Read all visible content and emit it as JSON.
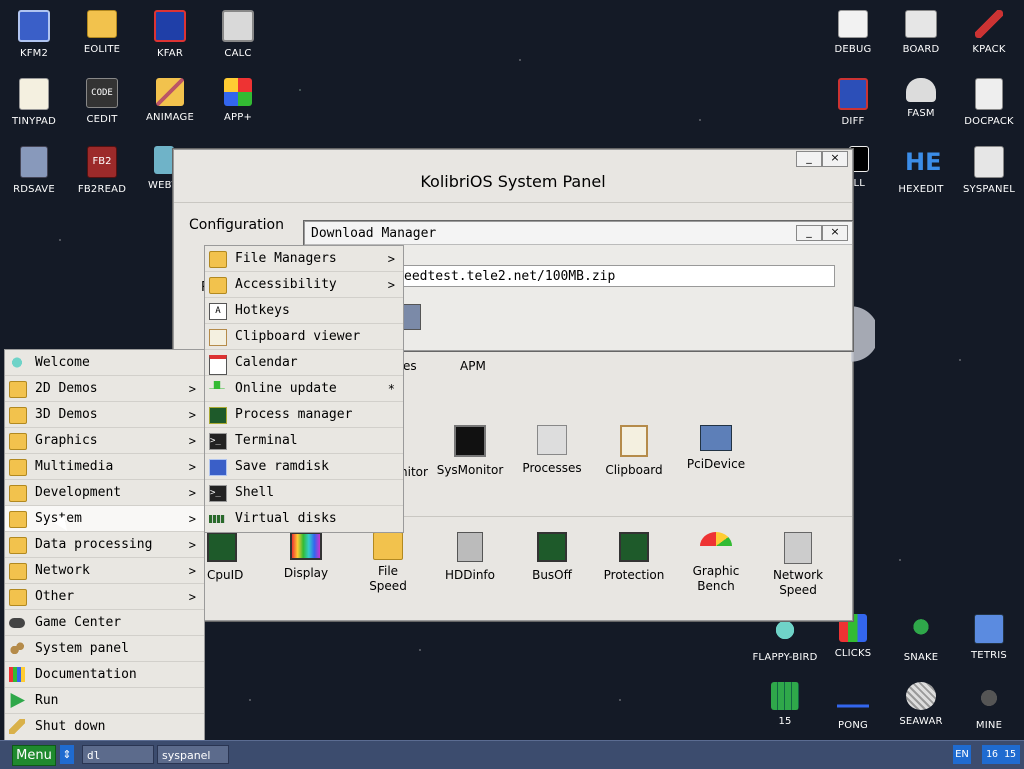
{
  "desktop_icons": [
    {
      "label": "KFM2",
      "icon": "floppy-icon"
    },
    {
      "label": "EOLITE",
      "icon": "folder-icon"
    },
    {
      "label": "KFAR",
      "icon": "kfar-icon"
    },
    {
      "label": "CALC",
      "icon": "calculator-icon"
    },
    {
      "label": "TINYPAD",
      "icon": "notepad-icon"
    },
    {
      "label": "CEDIT",
      "icon": "code-icon"
    },
    {
      "label": "ANIMAGE",
      "icon": "paint-icon"
    },
    {
      "label": "APP+",
      "icon": "cube-icon"
    },
    {
      "label": "RDSAVE",
      "icon": "ramdisk-icon"
    },
    {
      "label": "FB2READ",
      "icon": "book-icon"
    },
    {
      "label": "WEBV",
      "icon": "browser-icon"
    },
    {
      "label": "DEBUG",
      "icon": "bug-icon"
    },
    {
      "label": "BOARD",
      "icon": "board-icon"
    },
    {
      "label": "KPACK",
      "icon": "hammer-icon"
    },
    {
      "label": "DIFF",
      "icon": "diff-icon"
    },
    {
      "label": "FASM",
      "icon": "fasm-icon"
    },
    {
      "label": "DOCPACK",
      "icon": "docpack-icon"
    },
    {
      "label": "ELL",
      "icon": "shell-icon"
    },
    {
      "label": "HEXEDIT",
      "icon": "hex-icon"
    },
    {
      "label": "SYSPANEL",
      "icon": "sliders-icon"
    },
    {
      "label": "FLAPPY-BIRD",
      "icon": "bird-icon"
    },
    {
      "label": "CLICKS",
      "icon": "blocks-icon"
    },
    {
      "label": "SNAKE",
      "icon": "snake-icon"
    },
    {
      "label": "TETRIS",
      "icon": "tetris-icon"
    },
    {
      "label": "15",
      "icon": "grid15-icon"
    },
    {
      "label": "PONG",
      "icon": "pong-icon"
    },
    {
      "label": "SEAWAR",
      "icon": "ship-icon"
    },
    {
      "label": "MINE",
      "icon": "mine-icon"
    }
  ],
  "system_panel": {
    "title": "KolibriOS System Panel",
    "section_configuration": "Configuration",
    "partial_label_1": "R",
    "partial_label_2": "es",
    "tab_apm": "APM",
    "row1": [
      {
        "label": "nitor",
        "icon": "monitor-icon"
      },
      {
        "label": "SysMonitor",
        "icon": "sysmonitor-icon"
      },
      {
        "label": "Processes",
        "icon": "processes-icon"
      },
      {
        "label": "Clipboard",
        "icon": "clipboard-icon"
      },
      {
        "label": "PciDevice",
        "icon": "pci-icon"
      }
    ],
    "row2": [
      {
        "label": "CpuID",
        "icon": "chip-icon"
      },
      {
        "label": "Display",
        "icon": "display-icon"
      },
      {
        "label": "File\nSpeed",
        "icon": "folder-icon"
      },
      {
        "label": "HDDinfo",
        "icon": "hdd-icon"
      },
      {
        "label": "BusOff",
        "icon": "chip-icon"
      },
      {
        "label": "Protection",
        "icon": "chip-icon"
      },
      {
        "label": "Graphic\nBench",
        "icon": "gauge-icon"
      },
      {
        "label": "Network\nSpeed",
        "icon": "download-icon"
      }
    ]
  },
  "download_manager": {
    "title": "Download Manager",
    "url": "eedtest.tele2.net/100MB.zip"
  },
  "main_menu": [
    {
      "label": "Welcome",
      "icon": "bird-icon",
      "arrow": ""
    },
    {
      "label": "2D Demos",
      "icon": "folder-icon",
      "arrow": ">"
    },
    {
      "label": "3D Demos",
      "icon": "folder-icon",
      "arrow": ">"
    },
    {
      "label": "Graphics",
      "icon": "folder-icon",
      "arrow": ">"
    },
    {
      "label": "Multimedia",
      "icon": "folder-icon",
      "arrow": ">"
    },
    {
      "label": "Development",
      "icon": "folder-icon",
      "arrow": ">"
    },
    {
      "label": "System",
      "icon": "folder-icon",
      "arrow": ">"
    },
    {
      "label": "Data processing",
      "icon": "folder-icon",
      "arrow": ">"
    },
    {
      "label": "Network",
      "icon": "folder-icon",
      "arrow": ">"
    },
    {
      "label": "Other",
      "icon": "folder-icon",
      "arrow": ">"
    },
    {
      "label": "Game Center",
      "icon": "gamepad-icon",
      "arrow": ""
    },
    {
      "label": "System panel",
      "icon": "gears-icon",
      "arrow": ""
    },
    {
      "label": "Documentation",
      "icon": "books-icon",
      "arrow": ""
    },
    {
      "label": "Run",
      "icon": "play-icon",
      "arrow": ""
    },
    {
      "label": "Shut down",
      "icon": "power-icon",
      "arrow": ""
    }
  ],
  "system_submenu": [
    {
      "label": "File Managers",
      "icon": "folder-icon",
      "arrow": ">"
    },
    {
      "label": "Accessibility",
      "icon": "folder-icon",
      "arrow": ">"
    },
    {
      "label": "Hotkeys",
      "icon": "keyboard-icon",
      "arrow": ""
    },
    {
      "label": "Clipboard viewer",
      "icon": "clipboard-icon",
      "arrow": ""
    },
    {
      "label": "Calendar",
      "icon": "calendar-icon",
      "arrow": ""
    },
    {
      "label": "Online update",
      "icon": "download-arrow-icon",
      "arrow": "*"
    },
    {
      "label": "Process manager",
      "icon": "chip-icon",
      "arrow": ""
    },
    {
      "label": "Terminal",
      "icon": "terminal-icon",
      "arrow": ""
    },
    {
      "label": "Save ramdisk",
      "icon": "floppy-icon",
      "arrow": ""
    },
    {
      "label": "Shell",
      "icon": "terminal-icon",
      "arrow": ""
    },
    {
      "label": "Virtual disks",
      "icon": "ram-icon",
      "arrow": ""
    }
  ],
  "taskbar": {
    "menu_label": "Menu",
    "arrow_label": "⇕",
    "tasks": [
      "dl",
      "syspanel"
    ],
    "lang": "EN",
    "clock": "16 15"
  },
  "colors": {
    "desktop_bg": "#141a26",
    "taskbar_bg": "#3c4c6e",
    "menu_button": "#1f8a2e",
    "tray_blue": "#1f6bd0"
  }
}
